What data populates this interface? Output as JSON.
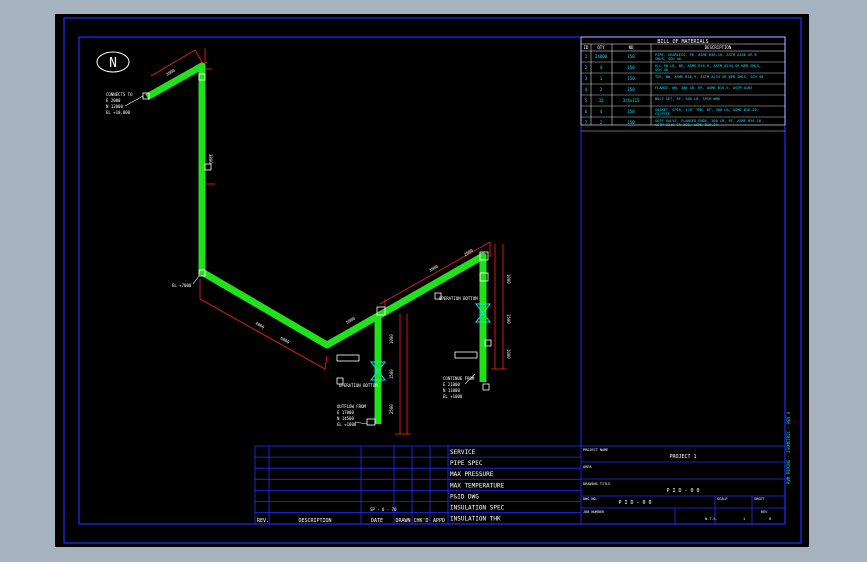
{
  "north_label": "N",
  "bom": {
    "title": "BILL OF MATERIALS",
    "headers": [
      "ID",
      "QTY",
      "ND",
      "DESCRIPTION"
    ],
    "rows": [
      [
        "1",
        "24000",
        "150",
        "PIPE, SEAMLESS, PE, ASME B36.10, ASTM A106 GR B SMLS, SCH 40"
      ],
      [
        "2",
        "4",
        "150",
        "ELL 90 LR, BE, ASME B16.9, ASTM A234 GR WPB SMLS, SCH 40"
      ],
      [
        "3",
        "1",
        "150",
        "TEE, BW, ASME B16.9, ASTM A234 GR WPB SMLS, SCH 40"
      ],
      [
        "4",
        "2",
        "150",
        "FLANGE, WN, 300 LB, RF, ASME B16.5, ASTM A105"
      ],
      [
        "5",
        "32",
        "3/4x115",
        "BOLT SET, RF, 300 LB, SPIR WND"
      ],
      [
        "6",
        "4",
        "150",
        "GASKET, SPIR, 1/8\" THK, RF, 300 LB, ASME B16.20, CS/PTFE"
      ],
      [
        "7",
        "2",
        "150",
        "GATE VALVE, FLANGED ENDS, 300 LB, RF, ASME B16.10, ASTM A216 GR WCB, ASME B16.34"
      ]
    ]
  },
  "annotations": {
    "connects_to_1": "CONNECTS TO",
    "connects_to_2": "E 2000",
    "connects_to_3": "N 12000",
    "connects_to_4": "EL +10,000",
    "elevation": "EL +7000",
    "operation_bottom_1": "OPERATION BOTTOM",
    "operation_bottom_2": "OPERATION BOTTOM",
    "outflow_1": "OUTFLOW FROM",
    "outflow_2": "E 17000",
    "outflow_3": "N 14500",
    "outflow_4": "EL +1000",
    "continue_1": "CONTINUE FROM",
    "continue_2": "E 21000",
    "continue_3": "N 11000",
    "continue_4": "EL +1000",
    "dims": [
      "3000",
      "3800",
      "4000",
      "5000",
      "3000",
      "2500",
      "1500",
      "1000",
      "1500",
      "1000",
      "1000",
      "6000",
      "2000"
    ]
  },
  "title_block": {
    "labels": [
      "SERVICE",
      "PIPE SPEC",
      "MAX PRESSURE",
      "MAX TEMPERATURE",
      "P&ID DWG",
      "INSULATION SPEC",
      "INSULATION THK"
    ],
    "rev_headers": [
      "REV.",
      "DESCRIPTION",
      "DATE",
      "DRAWN",
      "CHK'D",
      "APPD"
    ],
    "sheet_ref": "SP - 0 - 70",
    "project_label": "PROJECT NAME",
    "project_value": "PROJECT 1",
    "area_label": "AREA",
    "drawing_title_label": "DRAWING TITLE",
    "drawing_title_value": "P I D - 0 0",
    "dwg_no_label": "DWG NO.",
    "dwg_no_value": "P I D - 0 0",
    "job_label": "JOB NUMBER",
    "scale_label": "SCALE",
    "scale_value": "N.T.S.",
    "sheet_label": "SHEET",
    "sheet_value": "1",
    "rev_label": "REV",
    "rev_value": "0"
  },
  "colors": {
    "pipe": "#21e21a",
    "frame": "#1e2dff",
    "dimension": "#ff2020",
    "text": "#ffffff",
    "background": "#000000"
  }
}
